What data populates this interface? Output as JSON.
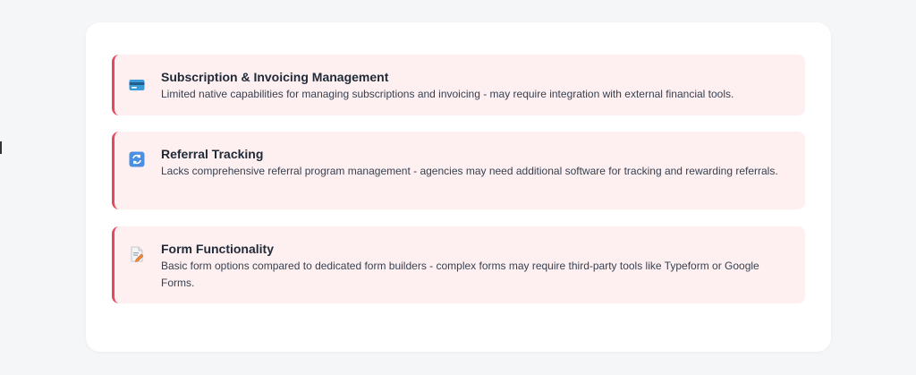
{
  "items": [
    {
      "icon": "credit-card-icon",
      "title": "Subscription & Invoicing Management",
      "description": "Limited native capabilities for managing subscriptions and invoicing - may require integration with external financial tools."
    },
    {
      "icon": "refresh-icon",
      "title": "Referral Tracking",
      "description": "Lacks comprehensive referral program management - agencies may need additional software for tracking and rewarding referrals."
    },
    {
      "icon": "form-document-icon",
      "title": "Form Functionality",
      "description": "Basic form options compared to dedicated form builders - complex forms may require third-party tools like Typeform or Google Forms."
    }
  ],
  "colors": {
    "accent": "#e5485e",
    "item_background": "#fef0f0",
    "card_background": "#ffffff",
    "page_background": "#f5f6f8"
  }
}
